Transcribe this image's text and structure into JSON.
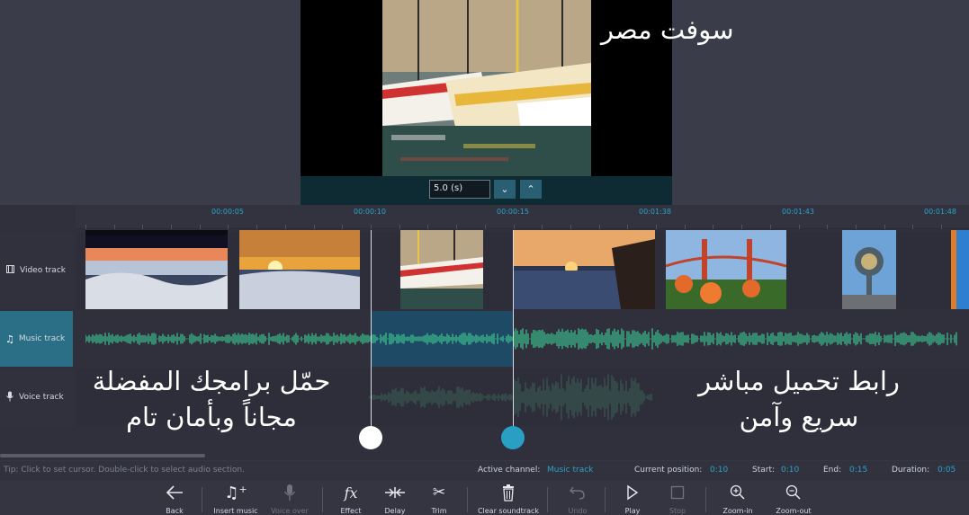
{
  "preview": {
    "duration_value": "5.0 (s)",
    "duration_down": "⌄",
    "duration_up": "⌃"
  },
  "overlay": {
    "top_text": "سوفت مصر",
    "left_line1": "حمّل برامجك المفضلة",
    "left_line2": "مجاناً وبأمان تام",
    "right_line1": "رابط تحميل مباشر",
    "right_line2": "سريع وآمن"
  },
  "ruler": {
    "ticks": [
      "00:00:05",
      "00:00:10",
      "00:00:15",
      "00:01:38",
      "00:01:43",
      "00:01:48"
    ]
  },
  "tracks": {
    "video": "Video track",
    "music": "Music track",
    "voice": "Voice track",
    "active_track": "music"
  },
  "status": {
    "tip": "Tip: Click to set cursor. Double-click to select audio section.",
    "active_channel_label": "Active channel:",
    "active_channel_value": "Music track",
    "current_position_label": "Current position:",
    "current_position_value": "0:10",
    "start_label": "Start:",
    "start_value": "0:10",
    "end_label": "End:",
    "end_value": "0:15",
    "duration_label": "Duration:",
    "duration_value": "0:05"
  },
  "toolbar": {
    "back": "Back",
    "insert_music": "Insert music",
    "voice_over": "Voice over",
    "effect": "Effect",
    "delay": "Delay",
    "trim": "Trim",
    "clear_soundtrack": "Clear soundtrack",
    "undo": "Undo",
    "play": "Play",
    "stop": "Stop",
    "zoom_in": "Zoom-in",
    "zoom_out": "Zoom-out"
  },
  "colors": {
    "accent": "#2aa3c9",
    "waveform": "#3cc58f",
    "selection": "#1f4a66",
    "active_track_bg": "#2a6f86"
  }
}
